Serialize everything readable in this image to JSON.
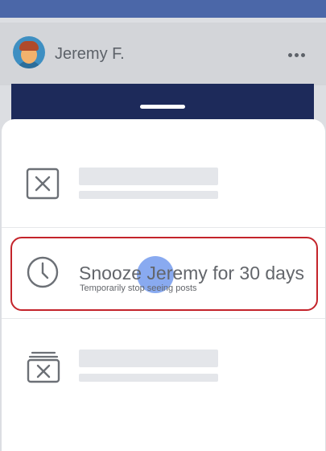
{
  "post": {
    "author_name": "Jeremy F."
  },
  "options": {
    "snooze": {
      "title": "Snooze Jeremy for 30 days",
      "subtitle": "Temporarily stop seeing posts"
    }
  },
  "icons": {
    "hide": "close-square-icon",
    "snooze": "clock-icon",
    "unfollow": "unfollow-stack-icon",
    "more": "more-horizontal-icon"
  },
  "colors": {
    "top_bar": "#4b67a8",
    "highlight": "#c4242b",
    "touch": "#618eeb"
  }
}
